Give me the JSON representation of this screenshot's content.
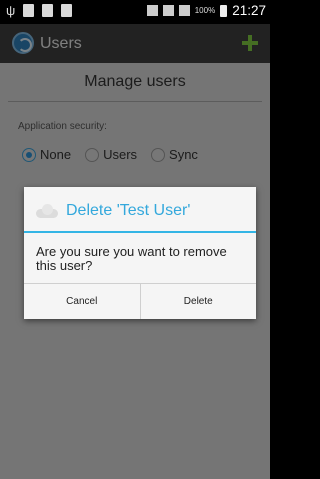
{
  "status_bar": {
    "battery": "100%",
    "time": "21:27"
  },
  "action_bar": {
    "title": "Users"
  },
  "content": {
    "page_title": "Manage users",
    "security_label": "Application security:",
    "options": [
      {
        "label": "None",
        "selected": true
      },
      {
        "label": "Users",
        "selected": false
      },
      {
        "label": "Sync",
        "selected": false
      }
    ]
  },
  "dialog": {
    "title": "Delete 'Test User'",
    "message": "Are you sure you want to remove this user?",
    "cancel_label": "Cancel",
    "delete_label": "Delete"
  },
  "colors": {
    "accent": "#33b5e5",
    "add_icon": "#7ec940",
    "radio_selected": "#2b91d3"
  }
}
